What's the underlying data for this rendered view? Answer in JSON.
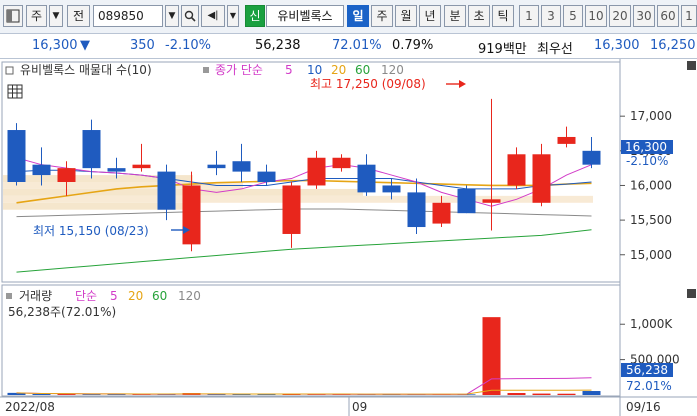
{
  "toolbar": {
    "stock_code": "089850",
    "stock_name": "유비벨록스",
    "label_main": "주",
    "label_prev": "전",
    "badge_new": "신",
    "period_day": "일",
    "period_week": "주",
    "period_month": "월",
    "period_year": "년",
    "period_minute": "분",
    "period_second": "초",
    "period_tick": "틱",
    "intervals": [
      "1",
      "3",
      "5",
      "10",
      "20",
      "30",
      "60",
      "1"
    ]
  },
  "quote": {
    "price": "16,300",
    "arrow": "▼",
    "change": "350",
    "change_pct": "-2.10%",
    "volume": "56,238",
    "vol_ratio": "72.01%",
    "turnover_ratio": "0.79%",
    "amount": "919백만",
    "best_ask_label": "최우선",
    "best_ask": "16,300",
    "best_bid": "16,250"
  },
  "price_panel": {
    "title": "유비벨록스 매물대 수(10)",
    "ma_label": "종가 단순",
    "ma_periods": [
      "5",
      "10",
      "20",
      "60",
      "120"
    ],
    "high_label": "최고 17,250 (09/08)",
    "low_label": "최저 15,150 (08/23)",
    "y_ticks": [
      "17,000",
      "16,500",
      "16,000",
      "15,500",
      "15,000"
    ],
    "current_price": "16,300",
    "current_pct": "-2.10%"
  },
  "volume_panel": {
    "title": "거래량",
    "ma_label": "단순",
    "ma_periods": [
      "5",
      "20",
      "60",
      "120"
    ],
    "current_volume_line": "56,238주(72.01%)",
    "y_ticks": [
      "1,000K",
      "500,000"
    ],
    "current_volume": "56,238",
    "current_pct": "72.01%"
  },
  "x_axis": {
    "labels": [
      "2022/08",
      "09",
      "09/16"
    ]
  },
  "colors": {
    "up": "#e8261c",
    "down": "#1f5bbf",
    "ma5": "#d23cc8",
    "ma10": "#1f5bbf",
    "ma20": "#e6a515",
    "ma60": "#27a33a",
    "ma120": "#8a8a8a",
    "high_label": "#e8261c",
    "low_label": "#1f5bbf"
  },
  "chart_data": {
    "type": "candlestick",
    "candles": [
      {
        "o": 16800,
        "h": 16900,
        "l": 16000,
        "c": 16050
      },
      {
        "o": 16300,
        "h": 16550,
        "l": 16000,
        "c": 16150
      },
      {
        "o": 16050,
        "h": 16350,
        "l": 15850,
        "c": 16250
      },
      {
        "o": 16800,
        "h": 16950,
        "l": 16100,
        "c": 16250
      },
      {
        "o": 16250,
        "h": 16400,
        "l": 16100,
        "c": 16200
      },
      {
        "o": 16250,
        "h": 16600,
        "l": 16200,
        "c": 16300
      },
      {
        "o": 16200,
        "h": 16300,
        "l": 15500,
        "c": 15650
      },
      {
        "o": 15150,
        "h": 16200,
        "l": 15050,
        "c": 16000
      },
      {
        "o": 16300,
        "h": 16500,
        "l": 16150,
        "c": 16250
      },
      {
        "o": 16350,
        "h": 16600,
        "l": 16050,
        "c": 16200
      },
      {
        "o": 16200,
        "h": 16300,
        "l": 16000,
        "c": 16050
      },
      {
        "o": 15300,
        "h": 16050,
        "l": 15100,
        "c": 16000
      },
      {
        "o": 16000,
        "h": 16500,
        "l": 15950,
        "c": 16400
      },
      {
        "o": 16250,
        "h": 16450,
        "l": 16200,
        "c": 16400
      },
      {
        "o": 16300,
        "h": 16450,
        "l": 15850,
        "c": 15900
      },
      {
        "o": 16000,
        "h": 16100,
        "l": 15800,
        "c": 15900
      },
      {
        "o": 15900,
        "h": 16100,
        "l": 15300,
        "c": 15400
      },
      {
        "o": 15450,
        "h": 15850,
        "l": 15400,
        "c": 15750
      },
      {
        "o": 15950,
        "h": 16000,
        "l": 15600,
        "c": 15600
      },
      {
        "o": 15750,
        "h": 17250,
        "l": 15350,
        "c": 15800
      },
      {
        "o": 16000,
        "h": 16550,
        "l": 15950,
        "c": 16450
      },
      {
        "o": 15750,
        "h": 16600,
        "l": 15700,
        "c": 16450
      },
      {
        "o": 16600,
        "h": 16850,
        "l": 16550,
        "c": 16700
      },
      {
        "o": 16500,
        "h": 16700,
        "l": 16250,
        "c": 16300
      }
    ],
    "volumes": [
      30000,
      14000,
      14000,
      9000,
      11000,
      9000,
      12000,
      28000,
      12000,
      10000,
      9000,
      13000,
      9000,
      8000,
      9000,
      10000,
      10000,
      9000,
      9000,
      1100000,
      28000,
      20000,
      18000,
      56238
    ],
    "ma5": [
      16400,
      16300,
      16250,
      16200,
      16180,
      16150,
      16100,
      15950,
      15900,
      15950,
      16050,
      16100,
      16250,
      16300,
      16250,
      16150,
      16050,
      15900,
      15800,
      15700,
      15800,
      15950,
      16150,
      16300
    ],
    "ma10": [
      16200,
      16220,
      16220,
      16200,
      16180,
      16150,
      16100,
      16050,
      16000,
      16000,
      16000,
      16050,
      16100,
      16100,
      16100,
      16100,
      16050,
      16000,
      15950,
      15950,
      15950,
      16000,
      16020,
      16050
    ],
    "ma20": [
      15750,
      15800,
      15850,
      15900,
      15950,
      15980,
      16000,
      16020,
      16040,
      16050,
      16060,
      16070,
      16070,
      16060,
      16050,
      16040,
      16030,
      16020,
      16010,
      16000,
      16000,
      16000,
      16020,
      16030
    ],
    "ma60": [
      14750,
      14780,
      14810,
      14840,
      14870,
      14900,
      14930,
      14960,
      14990,
      15020,
      15050,
      15080,
      15100,
      15120,
      15140,
      15160,
      15180,
      15200,
      15220,
      15240,
      15260,
      15280,
      15320,
      15360
    ],
    "ma120": [
      15550,
      15560,
      15570,
      15580,
      15590,
      15600,
      15610,
      15620,
      15630,
      15640,
      15650,
      15660,
      15660,
      15660,
      15650,
      15640,
      15630,
      15620,
      15610,
      15600,
      15590,
      15580,
      15570,
      15560
    ],
    "ylim": [
      14650,
      17450
    ],
    "vol_ylim": [
      0,
      1300000
    ]
  }
}
